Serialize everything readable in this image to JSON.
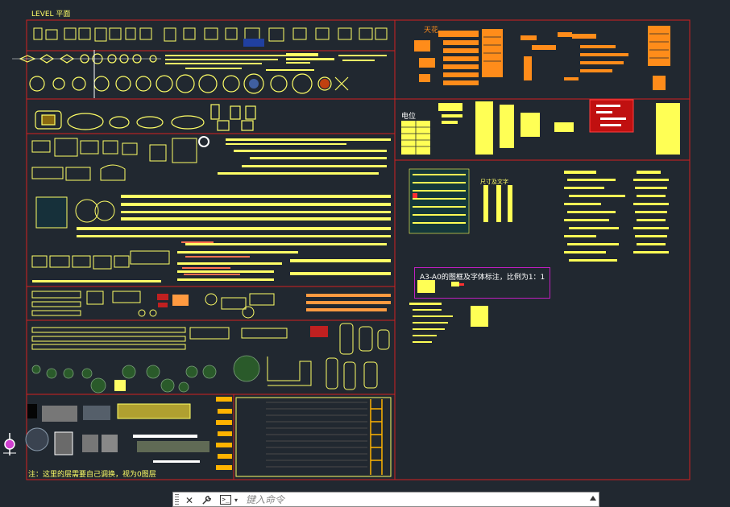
{
  "drawing": {
    "level_title": "LEVEL 平面",
    "label_ceiling": "天花",
    "label_electrical": "电位",
    "label_dimensions_text": "尺寸及文字",
    "scale_note": "A3-A0的图框及字体标注，比例为1：1",
    "layer_note": "注：这里的层需要自己调换，视为0图层",
    "colors": {
      "background": "#212830",
      "frame": "#d42020",
      "symbol_yellow": "#ffff55",
      "symbol_orange": "#ff8c1a",
      "note_frame": "#c01fc0"
    }
  },
  "command_line": {
    "placeholder": "键入命令",
    "close_icon": "close-icon",
    "settings_icon": "wrench-icon",
    "prompt_icon": "command-prompt-icon",
    "scroll_icon": "caret-up-icon"
  }
}
